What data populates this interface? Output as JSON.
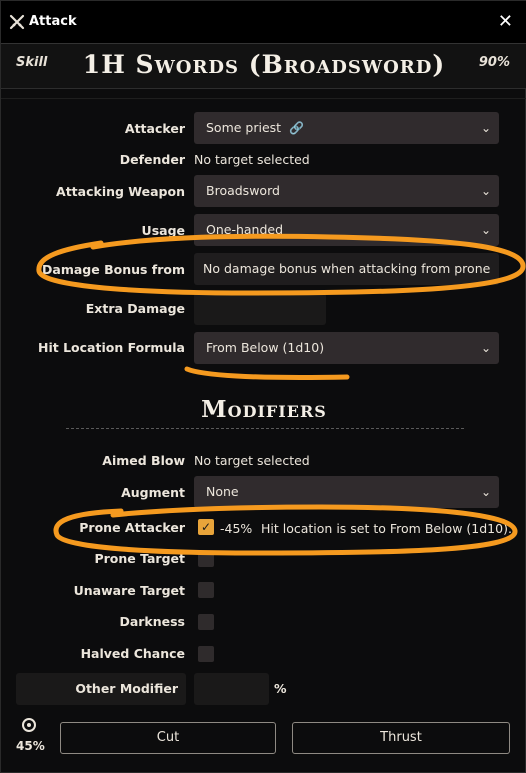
{
  "window": {
    "title": "Attack",
    "close_glyph": "✕",
    "icon": "crossed-swords-icon"
  },
  "header": {
    "skill_label": "Skill",
    "title": "1H Swords (Broadsword)",
    "percent": "90%"
  },
  "fields": {
    "attacker": {
      "label": "Attacker",
      "value": "Some priest",
      "link_icon": "🔗"
    },
    "defender": {
      "label": "Defender",
      "value": "No target selected"
    },
    "weapon": {
      "label": "Attacking Weapon",
      "value": "Broadsword"
    },
    "usage": {
      "label": "Usage",
      "value": "One-handed"
    },
    "damage_bonus": {
      "label": "Damage Bonus from",
      "value": "No damage bonus when attacking from prone"
    },
    "extra_damage": {
      "label": "Extra Damage",
      "value": ""
    },
    "hit_location": {
      "label": "Hit Location Formula",
      "value": "From Below (1d10)"
    }
  },
  "modifiers": {
    "title": "Modifiers",
    "aimed_blow": {
      "label": "Aimed Blow",
      "value": "No target selected"
    },
    "augment": {
      "label": "Augment",
      "value": "None"
    },
    "prone_attacker": {
      "label": "Prone Attacker",
      "checked": true,
      "modifier": "-45%",
      "note": "Hit location is set to From Below (1d10)."
    },
    "prone_target": {
      "label": "Prone Target",
      "checked": false
    },
    "unaware_target": {
      "label": "Unaware Target",
      "checked": false
    },
    "darkness": {
      "label": "Darkness",
      "checked": false
    },
    "halved_chance": {
      "label": "Halved Chance",
      "checked": false
    },
    "other_modifier": {
      "label": "Other Modifier",
      "value": "",
      "unit": "%"
    }
  },
  "footer": {
    "chance": "45%",
    "chance_icon": "target-icon",
    "cut_label": "Cut",
    "thrust_label": "Thrust"
  },
  "colors": {
    "accent": "#e8a43a",
    "annotation": "#f59a1f",
    "select_bg": "#302b2d",
    "background": "#0c0c0d"
  }
}
